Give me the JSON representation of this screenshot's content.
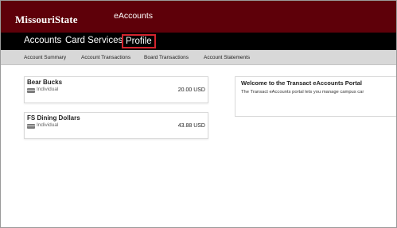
{
  "header": {
    "logo": "MissouriState",
    "app_title": "eAccounts"
  },
  "main_nav": {
    "items": [
      {
        "label": "Accounts"
      },
      {
        "label": "Card Services"
      },
      {
        "label": "Profile",
        "highlighted": true
      }
    ]
  },
  "sub_nav": {
    "items": [
      {
        "label": "Account Summary"
      },
      {
        "label": "Account Transactions"
      },
      {
        "label": "Board Transactions"
      },
      {
        "label": "Account Statements"
      }
    ]
  },
  "accounts": [
    {
      "name": "Bear Bucks",
      "type": "Individual",
      "balance": "20.00 USD",
      "icon": "card-icon"
    },
    {
      "name": "FS Dining Dollars",
      "type": "Individual",
      "balance": "43.88 USD",
      "icon": "card-icon"
    }
  ],
  "welcome": {
    "title": "Welcome to the Transact eAccounts Portal",
    "body": "The Transact eAccounts portal lets you manage campus car"
  },
  "colors": {
    "brand_maroon": "#5e0009",
    "nav_black": "#000000",
    "highlight_red": "#d3242e",
    "subnav_gray": "#d8d8d8"
  }
}
